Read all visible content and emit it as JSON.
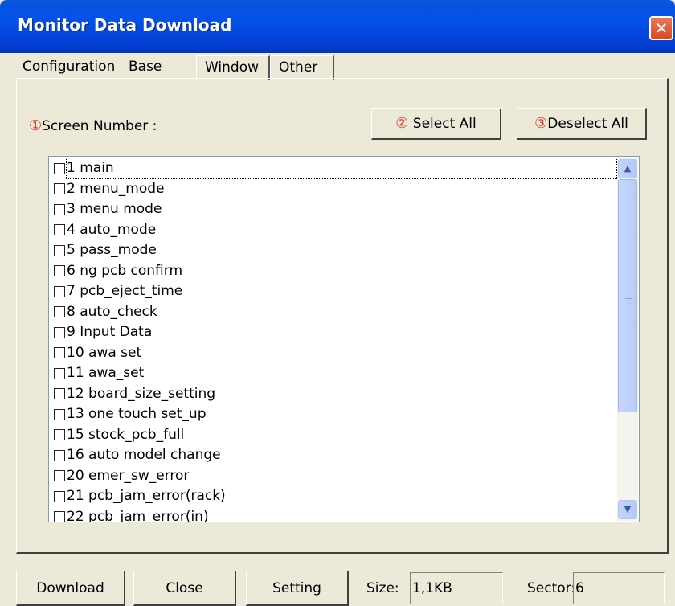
{
  "window": {
    "title": "Monitor Data Download",
    "close_glyph": "✕"
  },
  "tabs": [
    {
      "label": "Configuration",
      "active": false
    },
    {
      "label": "Base",
      "active": true
    },
    {
      "label": "Window",
      "active": false
    },
    {
      "label": "Other",
      "active": false
    }
  ],
  "screen_number": {
    "marker": "①",
    "label": "Screen Number :"
  },
  "buttons": {
    "select_all": {
      "marker": "②",
      "label": "Select All"
    },
    "deselect_all": {
      "marker": "③",
      "label": "Deselect All"
    }
  },
  "list": {
    "items": [
      {
        "label": "1 main",
        "checked": false
      },
      {
        "label": "2 menu_mode",
        "checked": false
      },
      {
        "label": "3 menu mode",
        "checked": false
      },
      {
        "label": "4 auto_mode",
        "checked": false
      },
      {
        "label": "5 pass_mode",
        "checked": false
      },
      {
        "label": "6 ng pcb confirm",
        "checked": false
      },
      {
        "label": "7 pcb_eject_time",
        "checked": false
      },
      {
        "label": "8 auto_check",
        "checked": false
      },
      {
        "label": "9 Input Data",
        "checked": false
      },
      {
        "label": "10 awa set",
        "checked": false
      },
      {
        "label": "11 awa_set",
        "checked": false
      },
      {
        "label": "12 board_size_setting",
        "checked": false
      },
      {
        "label": "13 one touch set_up",
        "checked": false
      },
      {
        "label": "15 stock_pcb_full",
        "checked": false
      },
      {
        "label": "16 auto model change",
        "checked": false
      },
      {
        "label": "20 emer_sw_error",
        "checked": false
      },
      {
        "label": "21 pcb_jam_error(rack)",
        "checked": false
      },
      {
        "label": "22 pcb_jam_error(in)",
        "checked": false
      }
    ],
    "scroll_up_icon": "▲",
    "scroll_down_icon": "▼"
  },
  "footer": {
    "download_label": "Download",
    "close_label": "Close",
    "setting_label": "Setting",
    "size_label": "Size:",
    "size_value": "1,1KB",
    "sector_label": "Sector:",
    "sector_value": "6"
  },
  "colors": {
    "titlebar": "#0550ea",
    "marker": "#e03020",
    "window_bg": "#ece9d8"
  }
}
